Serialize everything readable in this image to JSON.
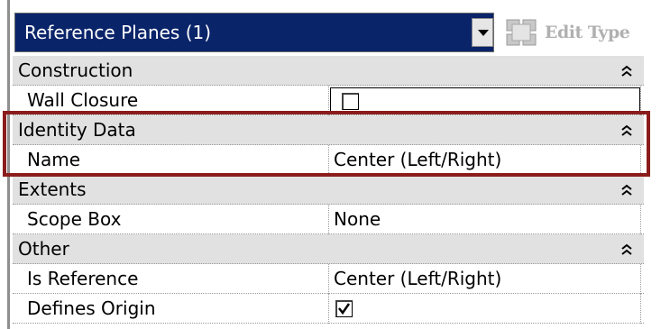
{
  "type_selector": {
    "selected": "Reference Planes (1)"
  },
  "edit_type": {
    "label": "Edit Type"
  },
  "groups": {
    "construction": {
      "title": "Construction"
    },
    "identity_data": {
      "title": "Identity Data"
    },
    "extents": {
      "title": "Extents"
    },
    "other": {
      "title": "Other"
    }
  },
  "properties": {
    "wall_closure": {
      "label": "Wall Closure",
      "checked": false
    },
    "name": {
      "label": "Name",
      "value": "Center (Left/Right)"
    },
    "scope_box": {
      "label": "Scope Box",
      "value": "None"
    },
    "is_reference": {
      "label": "Is Reference",
      "value": "Center (Left/Right)"
    },
    "defines_origin": {
      "label": "Defines Origin",
      "checked": true
    }
  },
  "colors": {
    "selector_bg": "#0a246a",
    "group_bg": "#e1e1e1",
    "highlight": "#8b1c1c"
  }
}
